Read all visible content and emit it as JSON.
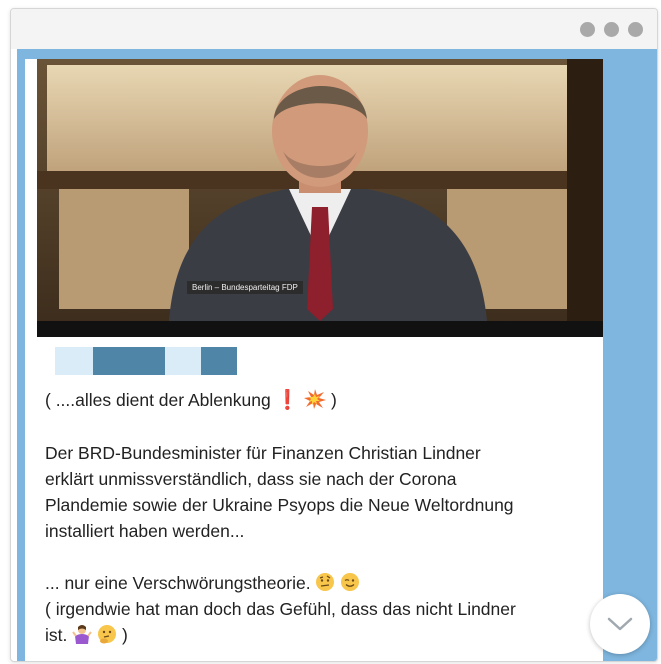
{
  "window": {
    "title_dots": [
      "",
      "",
      ""
    ]
  },
  "message": {
    "video_caption": "Berlin – Bundesparteitag FDP",
    "line1_text": "( ....alles dient der Ablenkung",
    "line1_end": ")",
    "paragraph": [
      "Der BRD-Bundesminister für Finanzen Christian Lindner",
      "erklärt unmissverständlich, dass sie nach der Corona",
      "Plandemie sowie der Ukraine Psyops die Neue Weltordnung",
      "installiert haben werden..."
    ],
    "line_theory": "... nur eine Verschwörungstheorie.",
    "line_feeling": "( irgendwie hat man doch das Gefühl, dass das nicht Lindner",
    "line_last_start": "ist.",
    "line_last_end": ")"
  },
  "colors": {
    "chat_background": "#7eb6df",
    "redacted_blocks": [
      "#d9ecf7",
      "#4f86a7",
      "#d9ecf7",
      "#4f86a7"
    ]
  },
  "icons": {
    "scroll_down": "chevron-down-icon",
    "exclamation": "red-exclamation-icon",
    "collision": "collision-icon",
    "emoji_raised_eyebrow": "raised-eyebrow-face-icon",
    "emoji_wink": "winking-face-icon",
    "emoji_shrug": "shrugging-woman-icon",
    "emoji_thinking": "thinking-face-icon"
  }
}
